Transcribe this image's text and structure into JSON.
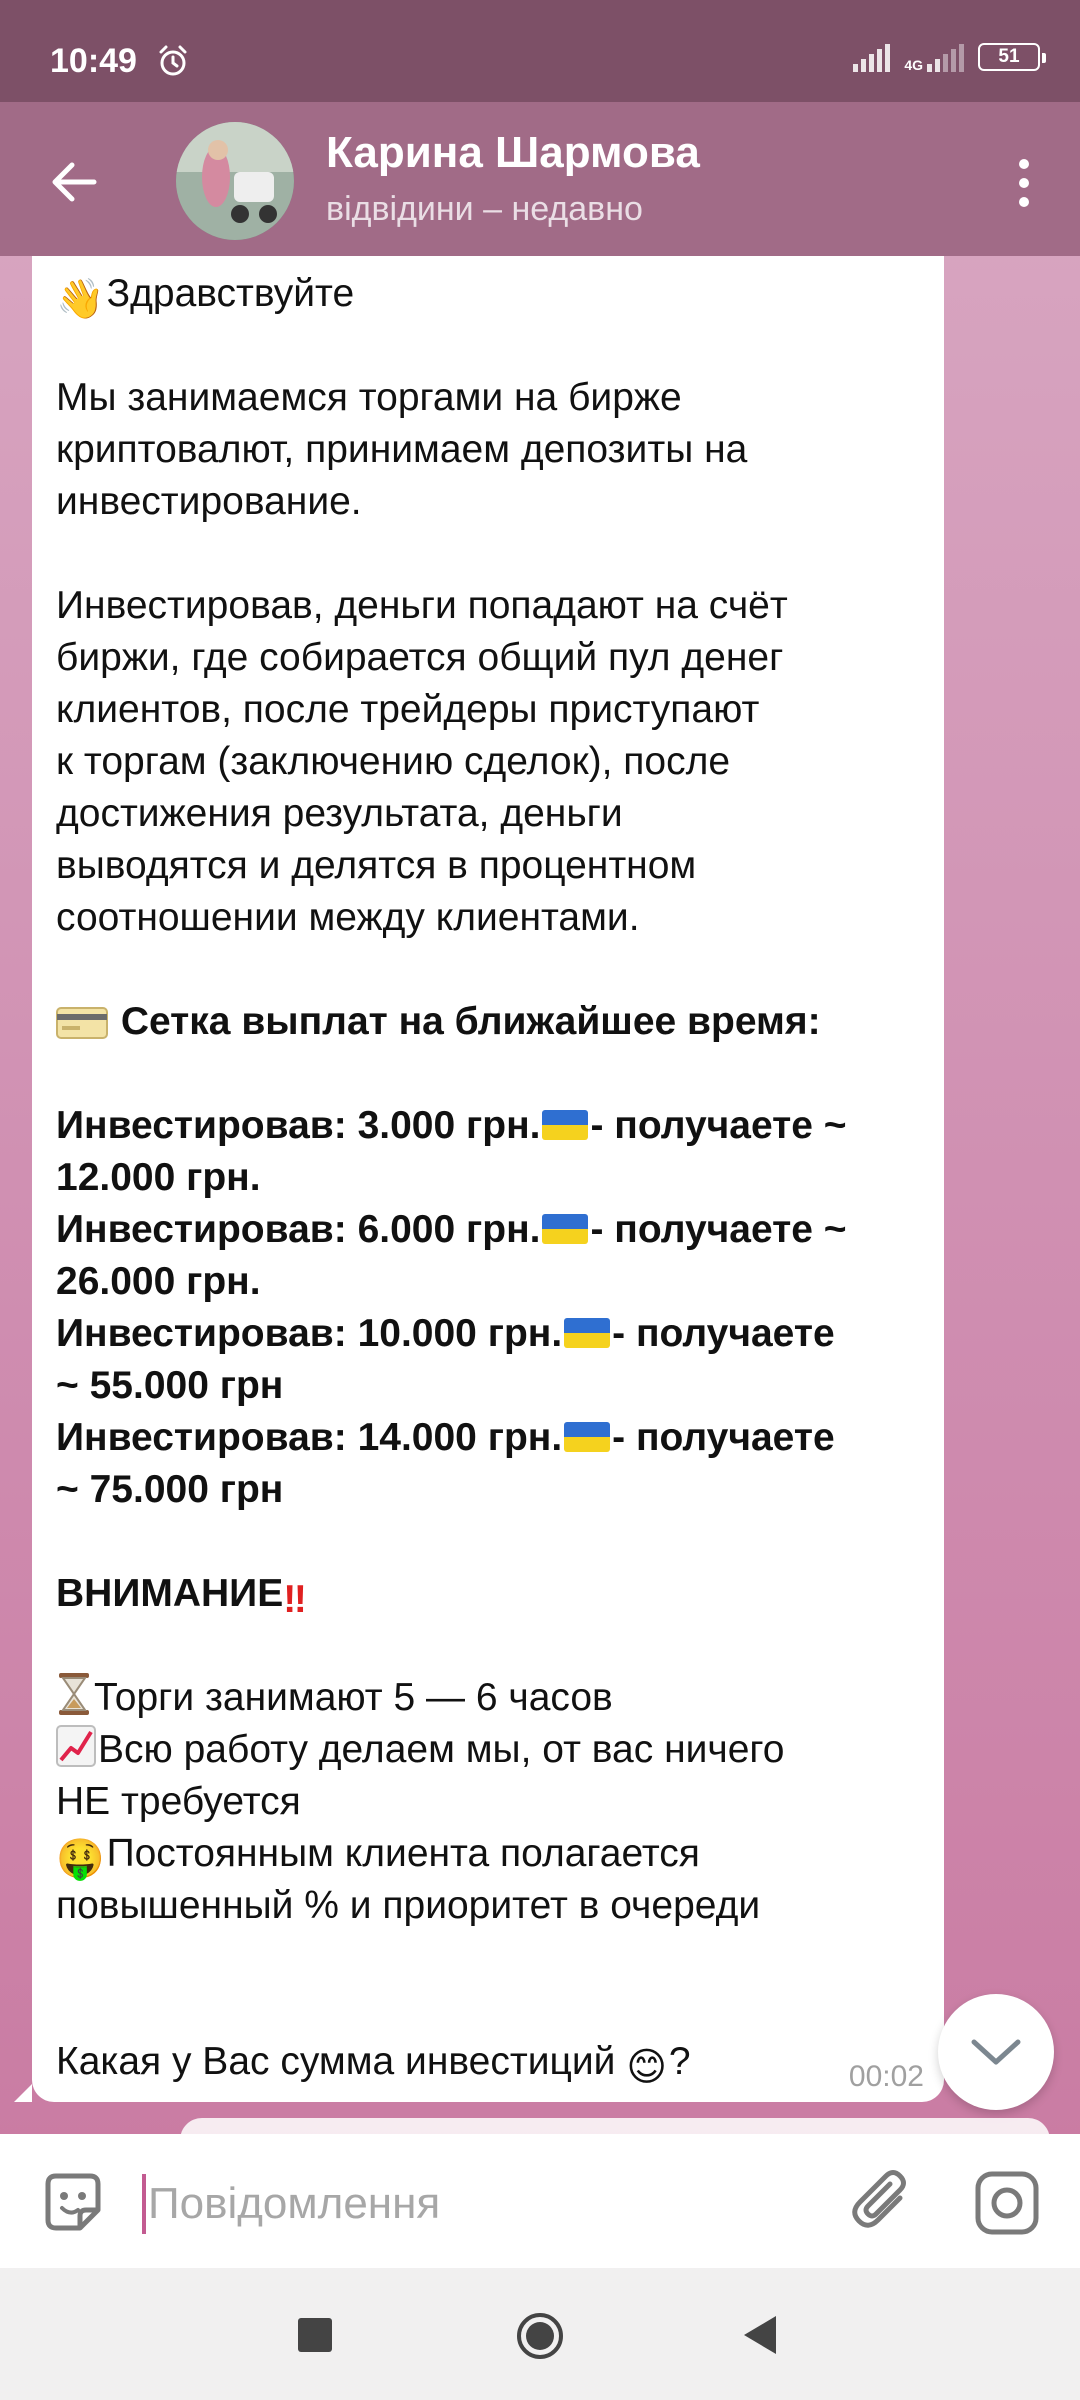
{
  "status_bar": {
    "time": "10:49",
    "network": "4G",
    "battery": "51"
  },
  "header": {
    "contact_name": "Карина Шармова",
    "last_seen": "відвідини – недавно"
  },
  "message": {
    "greeting": "Здравствуйте",
    "p1": [
      "Мы занимаемся торгами на бирже",
      "криптовалют, принимаем депозиты на",
      "инвестирование."
    ],
    "p2": [
      "Инвестировав, деньги попадают на счёт",
      "биржи, где собирается общий пул денег",
      "клиентов, после трейдеры приступают",
      "к торгам (заключению сделок), после",
      "достижения результата, деньги",
      "выводятся и делятся в процентном",
      "соотношении между клиентами."
    ],
    "grid_title": "Сетка выплат на ближайшее время:",
    "payouts": [
      {
        "a": "Инвестировав: 3.000 грн.",
        "b": "- получаете ~",
        "c": "12.000 грн."
      },
      {
        "a": "Инвестировав: 6.000 грн.",
        "b": "- получаете ~",
        "c": "26.000 грн."
      },
      {
        "a": "Инвестировав: 10.000 грн.",
        "b": "- получаете",
        "c": "~ 55.000 грн"
      },
      {
        "a": "Инвестировав: 14.000 грн.",
        "b": "- получаете",
        "c": "~ 75.000 грн"
      }
    ],
    "attention": "ВНИМАНИЕ",
    "bullet1": "Торги занимают 5 — 6 часов",
    "bullet2_l1": "Всю работу делаем мы, от вас ничего",
    "bullet2_l2": "НЕ требуется",
    "bullet3_l1": "Постоянным клиента полагается",
    "bullet3_l2": "повышенный % и приоритет в очереди",
    "question": "Какая у Вас сумма инвестиций",
    "question_end": "?",
    "time": "00:02"
  },
  "input": {
    "placeholder": "Повідомлення"
  },
  "icons": {
    "back": "arrow-left-icon",
    "menu": "vertical-dots-icon",
    "scroll": "chevron-down-icon",
    "emoji": "sticker-icon",
    "attach": "paperclip-icon",
    "camera": "camera-icon"
  },
  "colors": {
    "status_bar": "#7d5067",
    "app_bar": "#a16b87",
    "caret": "#c35b91",
    "flag_blue": "#2f6fd1",
    "flag_yellow": "#f5d21e"
  }
}
